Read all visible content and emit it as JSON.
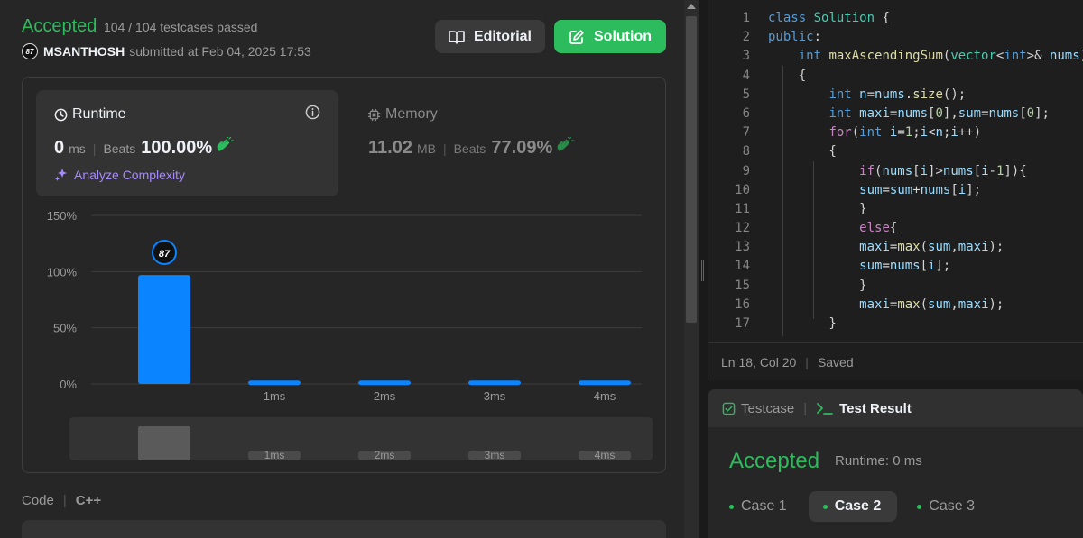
{
  "submission": {
    "status": "Accepted",
    "testcases_text": "104 / 104 testcases passed",
    "avatar_text": "87",
    "username": "MSANTHOSH",
    "submitted_text": "submitted at Feb 04, 2025 17:53"
  },
  "buttons": {
    "editorial": "Editorial",
    "solution": "Solution"
  },
  "runtime": {
    "label": "Runtime",
    "value": "0",
    "unit": "ms",
    "beats_label": "Beats",
    "beats_pct": "100.00%",
    "analyze_label": "Analyze Complexity"
  },
  "memory": {
    "label": "Memory",
    "value": "11.02",
    "unit": "MB",
    "beats_label": "Beats",
    "beats_pct": "77.09%"
  },
  "chart_data": {
    "type": "bar",
    "categories": [
      "",
      "1ms",
      "2ms",
      "3ms",
      "4ms"
    ],
    "values": [
      97,
      3,
      3,
      3,
      3
    ],
    "y_ticks": [
      "150%",
      "100%",
      "50%",
      "0%"
    ],
    "ylim": [
      0,
      150
    ],
    "marker_label": "87",
    "overview_categories": [
      "",
      "1ms",
      "2ms",
      "3ms",
      "4ms"
    ],
    "colors": {
      "bar": "#0a84ff",
      "grid": "#3e3e3e"
    }
  },
  "code_section": {
    "label": "Code",
    "language": "C++"
  },
  "editor": {
    "lines": [
      {
        "n": "1",
        "html": "<span class=\"kw\">class</span> <span class=\"ty\">Solution</span> {"
      },
      {
        "n": "2",
        "html": "<span class=\"kw\">public</span>:"
      },
      {
        "n": "3",
        "html": "    <span class=\"kw\">int</span> <span class=\"fn\">maxAscendingSum</span>(<span class=\"ty\">vector</span>&lt;<span class=\"kw\">int</span>&gt;&amp; <span class=\"vr\">nums</span>)"
      },
      {
        "n": "4",
        "html": "    {"
      },
      {
        "n": "5",
        "html": "        <span class=\"kw\">int</span> <span class=\"vr\">n</span>=<span class=\"vr\">nums</span>.<span class=\"fn\">size</span>();"
      },
      {
        "n": "6",
        "html": "        <span class=\"kw\">int</span> <span class=\"vr\">maxi</span>=<span class=\"vr\">nums</span>[<span class=\"nm\">0</span>],<span class=\"vr\">sum</span>=<span class=\"vr\">nums</span>[<span class=\"nm\">0</span>];"
      },
      {
        "n": "7",
        "html": "        <span class=\"ctl\">for</span>(<span class=\"kw\">int</span> <span class=\"vr\">i</span>=<span class=\"nm\">1</span>;<span class=\"vr\">i</span>&lt;<span class=\"vr\">n</span>;<span class=\"vr\">i</span>++)"
      },
      {
        "n": "8",
        "html": "        {"
      },
      {
        "n": "9",
        "html": "            <span class=\"ctl\">if</span>(<span class=\"vr\">nums</span>[<span class=\"vr\">i</span>]&gt;<span class=\"vr\">nums</span>[<span class=\"vr\">i</span>-<span class=\"nm\">1</span>]){"
      },
      {
        "n": "10",
        "html": "            <span class=\"vr\">sum</span>=<span class=\"vr\">sum</span>+<span class=\"vr\">nums</span>[<span class=\"vr\">i</span>];"
      },
      {
        "n": "11",
        "html": "            }"
      },
      {
        "n": "12",
        "html": "            <span class=\"ctl\">else</span>{"
      },
      {
        "n": "13",
        "html": "            <span class=\"vr\">maxi</span>=<span class=\"fn\">max</span>(<span class=\"vr\">sum</span>,<span class=\"vr\">maxi</span>);"
      },
      {
        "n": "14",
        "html": "            <span class=\"vr\">sum</span>=<span class=\"vr\">nums</span>[<span class=\"vr\">i</span>];"
      },
      {
        "n": "15",
        "html": "            }"
      },
      {
        "n": "16",
        "html": "            <span class=\"vr\">maxi</span>=<span class=\"fn\">max</span>(<span class=\"vr\">sum</span>,<span class=\"vr\">maxi</span>);"
      },
      {
        "n": "17",
        "html": "        }"
      }
    ],
    "status_pos": "Ln 18, Col 20",
    "status_saved": "Saved"
  },
  "result_panel": {
    "tab_testcase": "Testcase",
    "tab_result": "Test Result",
    "status": "Accepted",
    "runtime": "Runtime: 0 ms",
    "cases": [
      "Case 1",
      "Case 2",
      "Case 3"
    ],
    "active_case": 1
  }
}
